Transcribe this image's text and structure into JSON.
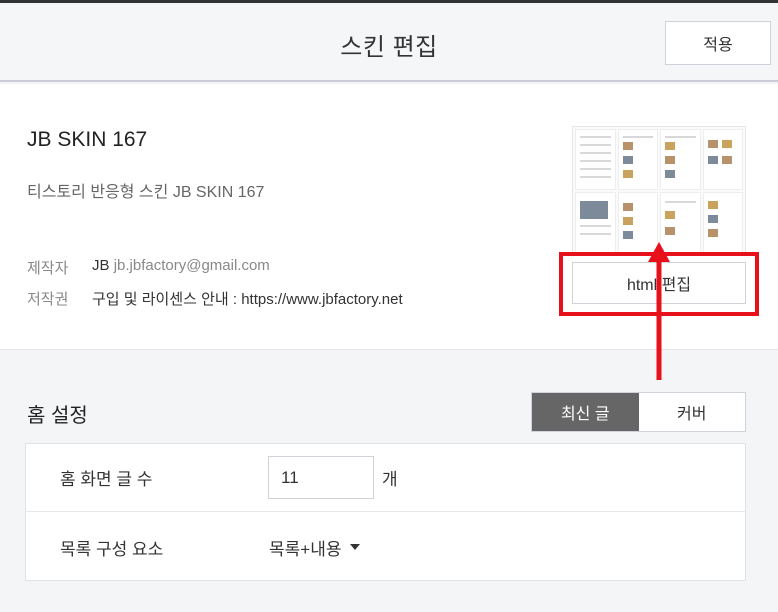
{
  "header": {
    "title": "스킨 편집",
    "apply_label": "적용"
  },
  "skin": {
    "name": "JB SKIN 167",
    "description": "티스토리 반응형 스킨 JB SKIN 167",
    "author_label": "제작자",
    "author_name": "JB",
    "author_email": "jb.jbfactory@gmail.com",
    "copyright_label": "저작권",
    "copyright_value": "구입 및 라이센스 안내 : https://www.jbfactory.net",
    "html_edit_label": "html 편집"
  },
  "annotation": {
    "highlight_color": "#e8101a"
  },
  "home_settings": {
    "title": "홈 설정",
    "tabs": [
      {
        "label": "최신 글",
        "active": true
      },
      {
        "label": "커버",
        "active": false
      }
    ],
    "post_count_label": "홈 화면 글 수",
    "post_count_value": "11",
    "post_count_unit": "개",
    "list_components_label": "목록 구성 요소",
    "list_components_value": "목록+내용"
  }
}
